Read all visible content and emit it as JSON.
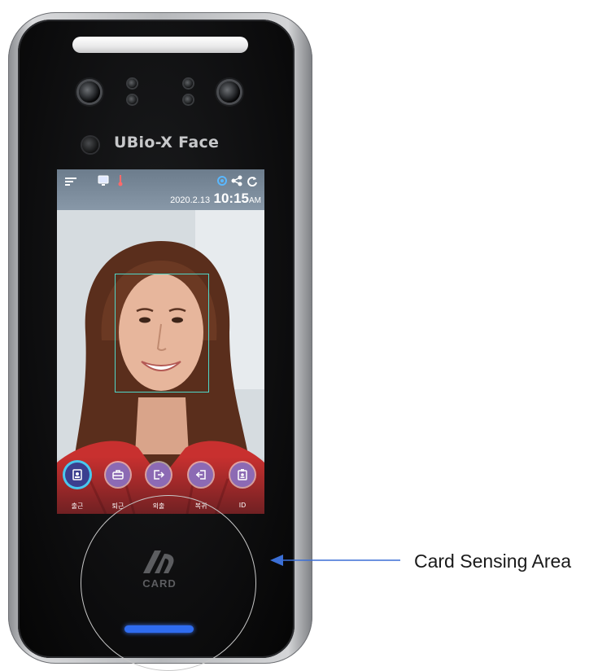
{
  "device": {
    "brand": "UBio-X Face"
  },
  "screen": {
    "date": "2020.2.13",
    "time": "10:15",
    "ampm": "AM",
    "status_icons": [
      "menu-icon",
      "monitor-icon",
      "thermometer-icon",
      "target-icon",
      "network-icon",
      "sync-icon"
    ]
  },
  "modes": [
    {
      "label": "출근",
      "icon": "id-card-icon",
      "active": true
    },
    {
      "label": "퇴근",
      "icon": "briefcase-icon",
      "active": false
    },
    {
      "label": "외출",
      "icon": "exit-icon",
      "active": false
    },
    {
      "label": "복귀",
      "icon": "enter-icon",
      "active": false
    },
    {
      "label": "ID",
      "icon": "badge-icon",
      "active": false
    }
  ],
  "card": {
    "label": "CARD"
  },
  "annotation": {
    "label": "Card Sensing Area"
  },
  "colors": {
    "accent": "#49c8ee",
    "mode_button": "#8c6ab4",
    "face_box": "#4fd6c8",
    "card_led": "#2f6cf0",
    "arrow": "#3b6fd6"
  }
}
